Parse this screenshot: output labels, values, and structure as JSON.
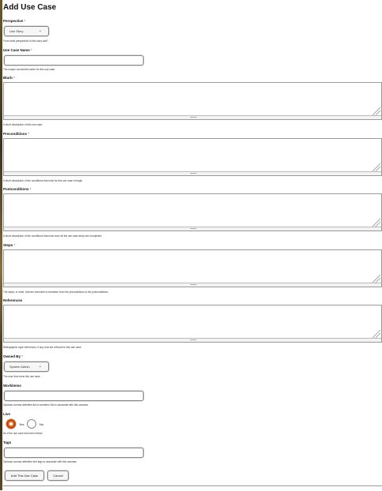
{
  "page": {
    "title": "Add Use Case"
  },
  "required_mark": "*",
  "perspective": {
    "label": "Perspective",
    "value": "Use Story",
    "help": "From what perspective is this story told?"
  },
  "use_case_name": {
    "label": "Use Case Name",
    "value": "",
    "help": "The unique convenient name for this use case."
  },
  "blurb": {
    "label": "Blurb",
    "value": "",
    "help": "A short description of this use case."
  },
  "preconditions": {
    "label": "Preconditions",
    "value": "",
    "help": "A short description of the conditions that exist for this use case to begin."
  },
  "postconditions": {
    "label": "Postconditions",
    "value": "",
    "help": "A short description of the conditions that exist once all the use case steps are completed."
  },
  "steps": {
    "label": "Steps",
    "value": "",
    "help": "The steps, in order, that are executed to transition from the preconditions to the postconditions."
  },
  "references": {
    "label": "References",
    "value": "",
    "help": "Bibliographic style references, if any, that are relevant to this use case."
  },
  "owned_by": {
    "label": "Owned By",
    "value": "System Admin",
    "help": "The user that owns this use case."
  },
  "workitems": {
    "label": "Workitems",
    "value": "",
    "help": "Optional comma delimited list of workitem IDs to associate with this usecase."
  },
  "live": {
    "label": "Live",
    "yes_label": "Yes",
    "no_label": "No",
    "selected": "Yes",
    "help": "No if the use case has been retired."
  },
  "tags": {
    "label": "Tags",
    "value": "",
    "help": "Optional comma delimited text tags to associate with this usecase."
  },
  "actions": {
    "submit_label": "Add This Use Case",
    "cancel_label": "Cancel"
  },
  "icons": {
    "select_chevron": "chevron-down-icon"
  },
  "colors": {
    "accent": "#e07030",
    "required": "#cc2233"
  }
}
